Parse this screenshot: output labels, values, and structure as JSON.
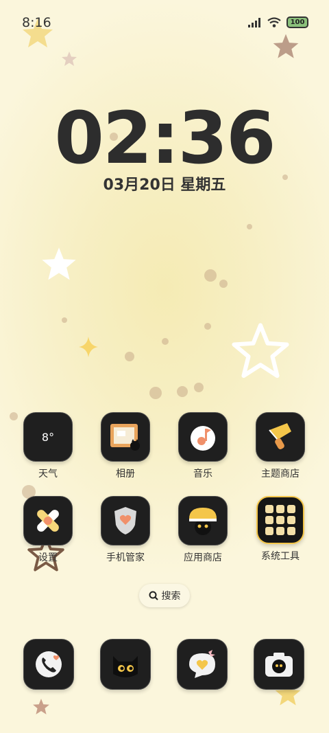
{
  "status_bar": {
    "time": "8:16",
    "battery": "100"
  },
  "lockscreen": {
    "time": "02:36",
    "date": "03月20日 星期五"
  },
  "weather": {
    "temp": "8°"
  },
  "apps_row1": [
    {
      "label": "天气",
      "icon": "weather-icon"
    },
    {
      "label": "相册",
      "icon": "gallery-icon"
    },
    {
      "label": "音乐",
      "icon": "music-icon"
    },
    {
      "label": "主题商店",
      "icon": "theme-store-icon"
    }
  ],
  "apps_row2": [
    {
      "label": "设置",
      "icon": "settings-icon"
    },
    {
      "label": "手机管家",
      "icon": "security-icon"
    },
    {
      "label": "应用商店",
      "icon": "app-store-icon"
    },
    {
      "label": "系统工具",
      "icon": "system-tools-folder-icon"
    }
  ],
  "search": {
    "label": "搜索"
  },
  "dock": [
    {
      "icon": "phone-icon"
    },
    {
      "icon": "black-cat-icon"
    },
    {
      "icon": "messages-icon"
    },
    {
      "icon": "camera-icon"
    }
  ],
  "colors": {
    "background": "#f7efc4",
    "icon_bg": "#1f1f1f",
    "accent_yellow": "#f4c64a",
    "accent_orange": "#f08b5a"
  }
}
